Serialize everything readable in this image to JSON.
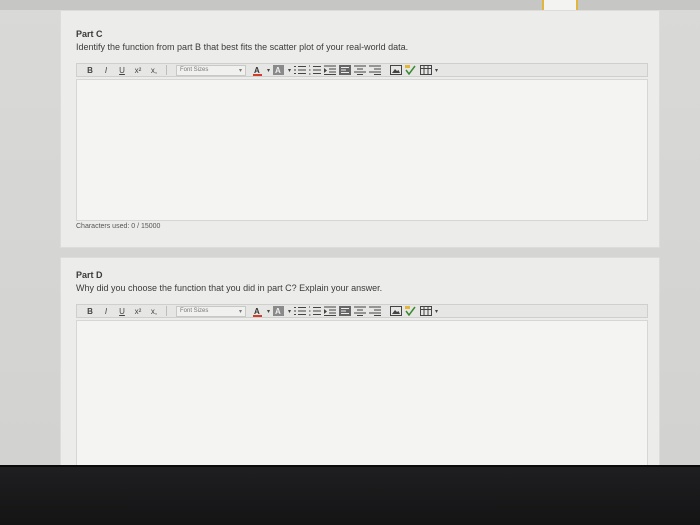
{
  "partC": {
    "title": "Part C",
    "prompt": "Identify the function from part B that best fits the scatter plot of your real-world data.",
    "chars_label": "Characters used: 0 / 15000"
  },
  "partD": {
    "title": "Part D",
    "prompt": "Why did you choose the function that you did in part C? Explain your answer."
  },
  "toolbar": {
    "bold": "B",
    "italic": "I",
    "underline": "U",
    "superscript": "x²",
    "subscript": "x,",
    "font_sizes": "Font Sizes",
    "font_color": "A",
    "highlight": "A"
  },
  "colors": {
    "font_color_bar": "#d23b2e",
    "accent": "#e2b63a",
    "check": "#3a8a2e"
  },
  "icons": [
    "bold",
    "italic",
    "underline",
    "superscript",
    "subscript",
    "font-size-dropdown",
    "font-color",
    "highlight-color",
    "unordered-list",
    "ordered-list",
    "indent",
    "align-left",
    "align-center",
    "align-right",
    "image",
    "equation",
    "table"
  ]
}
